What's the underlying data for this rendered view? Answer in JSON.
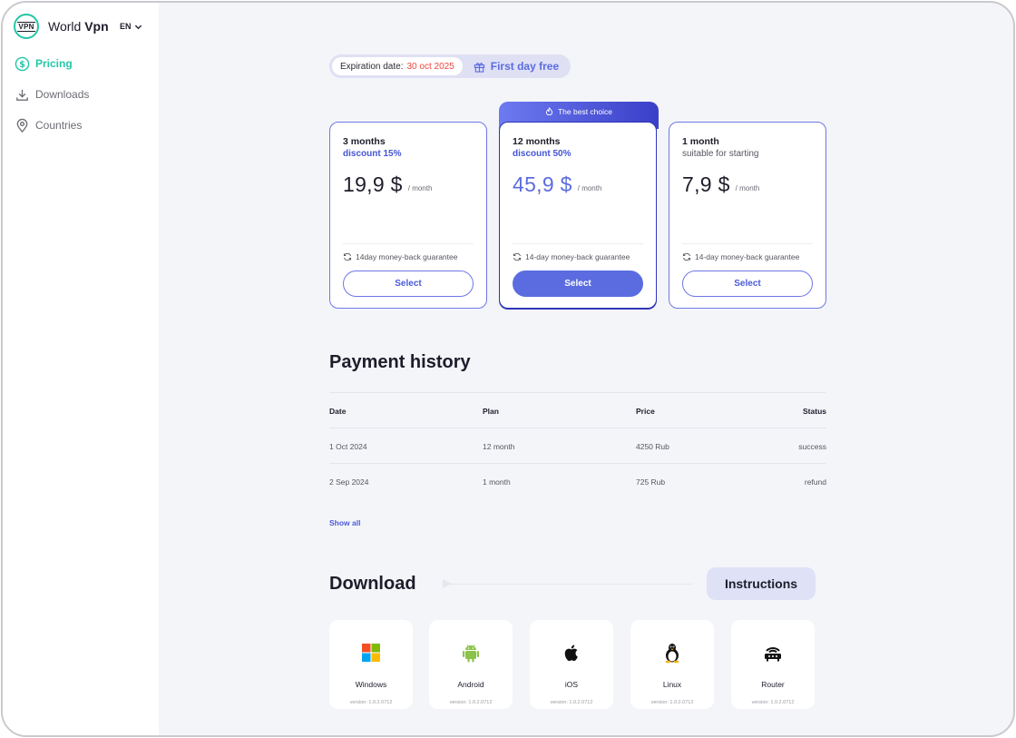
{
  "app": {
    "brand_light": "World",
    "brand_bold": "Vpn",
    "logo_text": "VPN",
    "language": "EN"
  },
  "nav": [
    {
      "label": "Pricing",
      "icon": "dollar-circle-icon",
      "active": true
    },
    {
      "label": "Downloads",
      "icon": "download-icon",
      "active": false
    },
    {
      "label": "Countries",
      "icon": "location-pin-icon",
      "active": false
    }
  ],
  "expiration": {
    "label": "Expiration date:",
    "date": "30 oct 2025",
    "promo": "First day free"
  },
  "best_badge": "The best choice",
  "plans": [
    {
      "name": "3 months",
      "subtitle": "discount 15%",
      "price": "19,9 $",
      "period": "/ month",
      "guarantee": "14day money-back guarantee",
      "button": "Select"
    },
    {
      "name": "12 months",
      "subtitle": "discount 50%",
      "price": "45,9 $",
      "period": "/ month",
      "guarantee": "14-day money-back guarantee",
      "button": "Select"
    },
    {
      "name": "1 month",
      "subtitle": "suitable for starting",
      "price": "7,9 $",
      "period": "/ month",
      "guarantee": "14-day money-back guarantee",
      "button": "Select"
    }
  ],
  "payment_history": {
    "title": "Payment history",
    "columns": [
      "Date",
      "Plan",
      "Price",
      "Status"
    ],
    "rows": [
      [
        "1 Oct 2024",
        "12 month",
        "4250 Rub",
        "success"
      ],
      [
        "2 Sep 2024",
        "1 month",
        "725 Rub",
        "refund"
      ]
    ],
    "show_all": "Show all"
  },
  "download": {
    "title": "Download",
    "instructions": "Instructions",
    "platforms": [
      {
        "name": "Windows",
        "icon": "windows-icon",
        "version": "version: 1.0.2.0712"
      },
      {
        "name": "Android",
        "icon": "android-icon",
        "version": "version: 1.0.2.0712"
      },
      {
        "name": "iOS",
        "icon": "apple-icon",
        "version": "version: 1.0.2.0712"
      },
      {
        "name": "Linux",
        "icon": "linux-tux-icon",
        "version": "version: 1.0.2.0712"
      },
      {
        "name": "Router",
        "icon": "router-icon",
        "version": "version: 1.0.2.0712"
      }
    ]
  },
  "colors": {
    "accent_teal": "#23c7a8",
    "accent_blue": "#5b6ce0",
    "date_red": "#f0463e",
    "background": "#f4f5f9"
  }
}
